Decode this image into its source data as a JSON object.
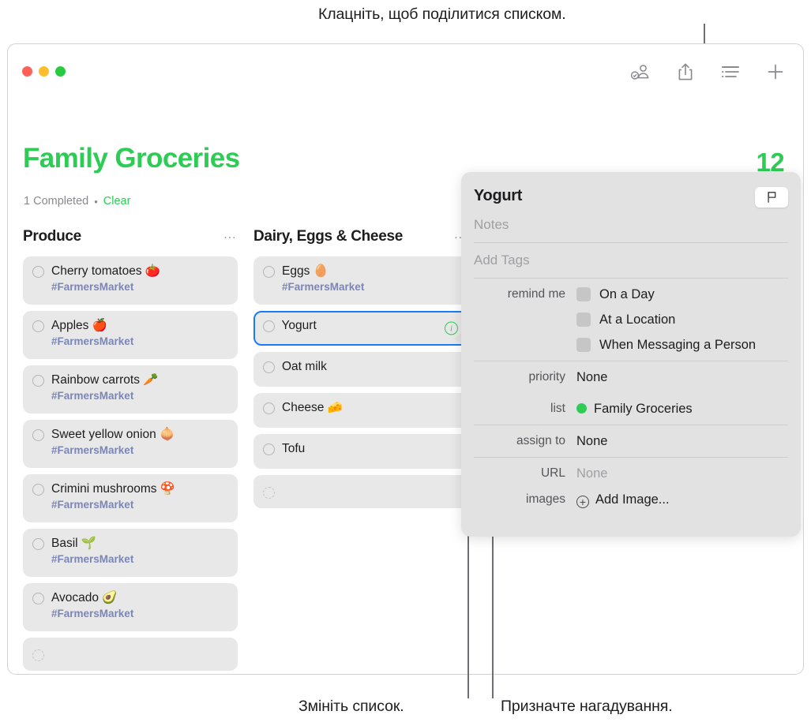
{
  "callouts": {
    "top": "Клацніть, щоб поділитися списком.",
    "bottom_left": "Змініть список.",
    "bottom_right": "Призначте нагадування."
  },
  "window": {
    "traffic_lights": [
      "close",
      "minimize",
      "zoom"
    ],
    "toolbar": [
      {
        "name": "assigned-reminders-icon",
        "label": "Assigned"
      },
      {
        "name": "share-icon",
        "label": "Share"
      },
      {
        "name": "view-options-icon",
        "label": "View Options"
      },
      {
        "name": "add-reminder-icon",
        "label": "Add"
      }
    ]
  },
  "header": {
    "title": "Family Groceries",
    "title_color": "#2ECC55",
    "count": "12",
    "completed_text": "1 Completed",
    "separator": "•",
    "clear_label": "Clear"
  },
  "columns": [
    {
      "name": "produce",
      "title": "Produce",
      "menu_label": "…",
      "items": [
        {
          "title": "Cherry tomatoes 🍅",
          "tag": "#FarmersMarket",
          "selected": false
        },
        {
          "title": "Apples 🍎",
          "tag": "#FarmersMarket",
          "selected": false
        },
        {
          "title": "Rainbow carrots 🥕",
          "tag": "#FarmersMarket",
          "selected": false
        },
        {
          "title": "Sweet yellow onion 🧅",
          "tag": "#FarmersMarket",
          "selected": false
        },
        {
          "title": "Crimini mushrooms 🍄",
          "tag": "#FarmersMarket",
          "selected": false
        },
        {
          "title": "Basil 🌱",
          "tag": "#FarmersMarket",
          "selected": false
        },
        {
          "title": "Avocado 🥑",
          "tag": "#FarmersMarket",
          "selected": false
        },
        {
          "title": "",
          "tag": "",
          "selected": false,
          "empty": true
        }
      ]
    },
    {
      "name": "dairy-eggs-cheese",
      "title": "Dairy, Eggs & Cheese",
      "menu_label": "…",
      "items": [
        {
          "title": "Eggs 🥚",
          "tag": "#FarmersMarket",
          "selected": false
        },
        {
          "title": "Yogurt",
          "tag": "",
          "selected": true,
          "info": "i"
        },
        {
          "title": "Oat milk",
          "tag": "",
          "selected": false
        },
        {
          "title": "Cheese 🧀",
          "tag": "",
          "selected": false
        },
        {
          "title": "Tofu",
          "tag": "",
          "selected": false
        },
        {
          "title": "",
          "tag": "",
          "selected": false,
          "empty": true
        }
      ]
    }
  ],
  "popover": {
    "title": "Yogurt",
    "flag_icon": "flag-icon",
    "notes_placeholder": "Notes",
    "tags_placeholder": "Add Tags",
    "remind_me_label": "remind me",
    "remind_options": [
      {
        "label": "On a Day",
        "checked": false
      },
      {
        "label": "At a Location",
        "checked": false
      },
      {
        "label": "When Messaging a Person",
        "checked": false
      }
    ],
    "priority_label": "priority",
    "priority_value": "None",
    "list_label": "list",
    "list_value": "Family Groceries",
    "list_color": "#2ECC55",
    "assign_label": "assign to",
    "assign_value": "None",
    "url_label": "URL",
    "url_value": "None",
    "images_label": "images",
    "images_value": "Add Image..."
  }
}
